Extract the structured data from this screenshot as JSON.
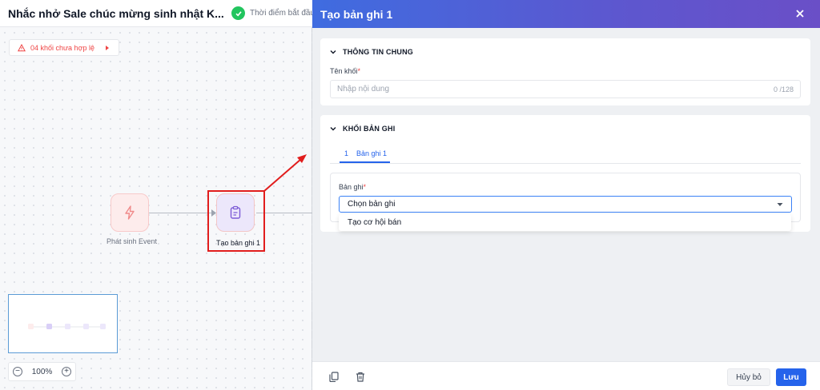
{
  "flow": {
    "title": "Nhắc nhở Sale chúc mừng sinh nhật K...",
    "status_text": "Thời điểm bắt đầu",
    "warning_text": "04 khối chưa hợp lệ",
    "zoom": "100%"
  },
  "nodes": [
    {
      "label": "Phát sinh Event",
      "icon": "lightning-icon"
    },
    {
      "label": "Tạo bản ghi 1",
      "icon": "clipboard-icon"
    }
  ],
  "drawer": {
    "title": "Tạo bản ghi 1",
    "general": {
      "title": "THÔNG TIN CHUNG",
      "name_label": "Tên khối",
      "name_placeholder": "Nhập nội dung",
      "name_counter": "0 /128"
    },
    "records": {
      "title": "KHỐI BẢN GHI",
      "tab_number": "1",
      "tab_label": "Bản ghi 1",
      "record_label": "Bản ghi",
      "select_value": "Chọn bản ghi",
      "options": [
        "Tạo cơ hội bán"
      ]
    },
    "footer": {
      "cancel_label": "Hủy bỏ",
      "save_label": "Lưu"
    }
  },
  "colors": {
    "primary": "#2563eb",
    "danger": "#ef4444",
    "success": "#22c55e",
    "header_gradient_start": "#3f6ce0",
    "header_gradient_end": "#6a4fc7"
  }
}
